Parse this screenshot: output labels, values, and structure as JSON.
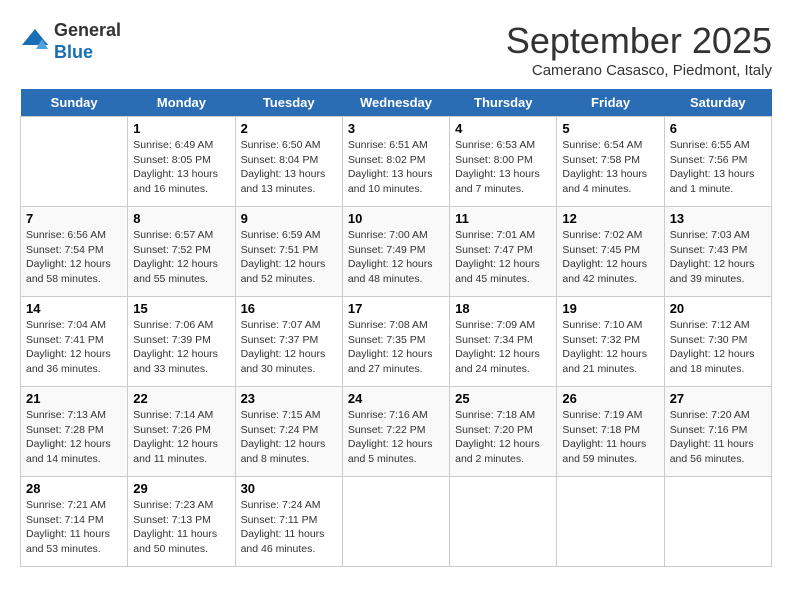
{
  "header": {
    "logo_line1": "General",
    "logo_line2": "Blue",
    "month_title": "September 2025",
    "location": "Camerano Casasco, Piedmont, Italy"
  },
  "days_of_week": [
    "Sunday",
    "Monday",
    "Tuesday",
    "Wednesday",
    "Thursday",
    "Friday",
    "Saturday"
  ],
  "weeks": [
    [
      {
        "date": "",
        "sunrise": "",
        "sunset": "",
        "daylight": ""
      },
      {
        "date": "1",
        "sunrise": "Sunrise: 6:49 AM",
        "sunset": "Sunset: 8:05 PM",
        "daylight": "Daylight: 13 hours and 16 minutes."
      },
      {
        "date": "2",
        "sunrise": "Sunrise: 6:50 AM",
        "sunset": "Sunset: 8:04 PM",
        "daylight": "Daylight: 13 hours and 13 minutes."
      },
      {
        "date": "3",
        "sunrise": "Sunrise: 6:51 AM",
        "sunset": "Sunset: 8:02 PM",
        "daylight": "Daylight: 13 hours and 10 minutes."
      },
      {
        "date": "4",
        "sunrise": "Sunrise: 6:53 AM",
        "sunset": "Sunset: 8:00 PM",
        "daylight": "Daylight: 13 hours and 7 minutes."
      },
      {
        "date": "5",
        "sunrise": "Sunrise: 6:54 AM",
        "sunset": "Sunset: 7:58 PM",
        "daylight": "Daylight: 13 hours and 4 minutes."
      },
      {
        "date": "6",
        "sunrise": "Sunrise: 6:55 AM",
        "sunset": "Sunset: 7:56 PM",
        "daylight": "Daylight: 13 hours and 1 minute."
      }
    ],
    [
      {
        "date": "7",
        "sunrise": "Sunrise: 6:56 AM",
        "sunset": "Sunset: 7:54 PM",
        "daylight": "Daylight: 12 hours and 58 minutes."
      },
      {
        "date": "8",
        "sunrise": "Sunrise: 6:57 AM",
        "sunset": "Sunset: 7:52 PM",
        "daylight": "Daylight: 12 hours and 55 minutes."
      },
      {
        "date": "9",
        "sunrise": "Sunrise: 6:59 AM",
        "sunset": "Sunset: 7:51 PM",
        "daylight": "Daylight: 12 hours and 52 minutes."
      },
      {
        "date": "10",
        "sunrise": "Sunrise: 7:00 AM",
        "sunset": "Sunset: 7:49 PM",
        "daylight": "Daylight: 12 hours and 48 minutes."
      },
      {
        "date": "11",
        "sunrise": "Sunrise: 7:01 AM",
        "sunset": "Sunset: 7:47 PM",
        "daylight": "Daylight: 12 hours and 45 minutes."
      },
      {
        "date": "12",
        "sunrise": "Sunrise: 7:02 AM",
        "sunset": "Sunset: 7:45 PM",
        "daylight": "Daylight: 12 hours and 42 minutes."
      },
      {
        "date": "13",
        "sunrise": "Sunrise: 7:03 AM",
        "sunset": "Sunset: 7:43 PM",
        "daylight": "Daylight: 12 hours and 39 minutes."
      }
    ],
    [
      {
        "date": "14",
        "sunrise": "Sunrise: 7:04 AM",
        "sunset": "Sunset: 7:41 PM",
        "daylight": "Daylight: 12 hours and 36 minutes."
      },
      {
        "date": "15",
        "sunrise": "Sunrise: 7:06 AM",
        "sunset": "Sunset: 7:39 PM",
        "daylight": "Daylight: 12 hours and 33 minutes."
      },
      {
        "date": "16",
        "sunrise": "Sunrise: 7:07 AM",
        "sunset": "Sunset: 7:37 PM",
        "daylight": "Daylight: 12 hours and 30 minutes."
      },
      {
        "date": "17",
        "sunrise": "Sunrise: 7:08 AM",
        "sunset": "Sunset: 7:35 PM",
        "daylight": "Daylight: 12 hours and 27 minutes."
      },
      {
        "date": "18",
        "sunrise": "Sunrise: 7:09 AM",
        "sunset": "Sunset: 7:34 PM",
        "daylight": "Daylight: 12 hours and 24 minutes."
      },
      {
        "date": "19",
        "sunrise": "Sunrise: 7:10 AM",
        "sunset": "Sunset: 7:32 PM",
        "daylight": "Daylight: 12 hours and 21 minutes."
      },
      {
        "date": "20",
        "sunrise": "Sunrise: 7:12 AM",
        "sunset": "Sunset: 7:30 PM",
        "daylight": "Daylight: 12 hours and 18 minutes."
      }
    ],
    [
      {
        "date": "21",
        "sunrise": "Sunrise: 7:13 AM",
        "sunset": "Sunset: 7:28 PM",
        "daylight": "Daylight: 12 hours and 14 minutes."
      },
      {
        "date": "22",
        "sunrise": "Sunrise: 7:14 AM",
        "sunset": "Sunset: 7:26 PM",
        "daylight": "Daylight: 12 hours and 11 minutes."
      },
      {
        "date": "23",
        "sunrise": "Sunrise: 7:15 AM",
        "sunset": "Sunset: 7:24 PM",
        "daylight": "Daylight: 12 hours and 8 minutes."
      },
      {
        "date": "24",
        "sunrise": "Sunrise: 7:16 AM",
        "sunset": "Sunset: 7:22 PM",
        "daylight": "Daylight: 12 hours and 5 minutes."
      },
      {
        "date": "25",
        "sunrise": "Sunrise: 7:18 AM",
        "sunset": "Sunset: 7:20 PM",
        "daylight": "Daylight: 12 hours and 2 minutes."
      },
      {
        "date": "26",
        "sunrise": "Sunrise: 7:19 AM",
        "sunset": "Sunset: 7:18 PM",
        "daylight": "Daylight: 11 hours and 59 minutes."
      },
      {
        "date": "27",
        "sunrise": "Sunrise: 7:20 AM",
        "sunset": "Sunset: 7:16 PM",
        "daylight": "Daylight: 11 hours and 56 minutes."
      }
    ],
    [
      {
        "date": "28",
        "sunrise": "Sunrise: 7:21 AM",
        "sunset": "Sunset: 7:14 PM",
        "daylight": "Daylight: 11 hours and 53 minutes."
      },
      {
        "date": "29",
        "sunrise": "Sunrise: 7:23 AM",
        "sunset": "Sunset: 7:13 PM",
        "daylight": "Daylight: 11 hours and 50 minutes."
      },
      {
        "date": "30",
        "sunrise": "Sunrise: 7:24 AM",
        "sunset": "Sunset: 7:11 PM",
        "daylight": "Daylight: 11 hours and 46 minutes."
      },
      {
        "date": "",
        "sunrise": "",
        "sunset": "",
        "daylight": ""
      },
      {
        "date": "",
        "sunrise": "",
        "sunset": "",
        "daylight": ""
      },
      {
        "date": "",
        "sunrise": "",
        "sunset": "",
        "daylight": ""
      },
      {
        "date": "",
        "sunrise": "",
        "sunset": "",
        "daylight": ""
      }
    ]
  ]
}
